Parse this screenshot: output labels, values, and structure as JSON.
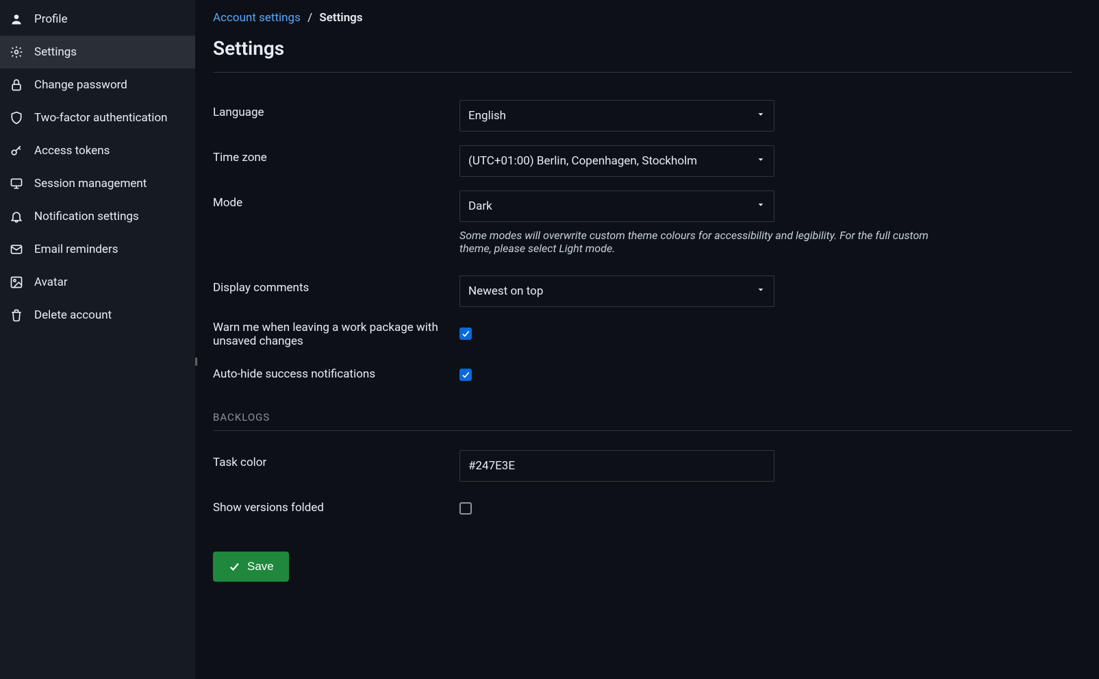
{
  "sidebar": {
    "items": [
      {
        "label": "Profile"
      },
      {
        "label": "Settings"
      },
      {
        "label": "Change password"
      },
      {
        "label": "Two-factor authentication"
      },
      {
        "label": "Access tokens"
      },
      {
        "label": "Session management"
      },
      {
        "label": "Notification settings"
      },
      {
        "label": "Email reminders"
      },
      {
        "label": "Avatar"
      },
      {
        "label": "Delete account"
      }
    ]
  },
  "breadcrumb": {
    "parent": "Account settings",
    "sep": "/",
    "current": "Settings"
  },
  "title": "Settings",
  "form": {
    "language_label": "Language",
    "language_value": "English",
    "timezone_label": "Time zone",
    "timezone_value": "(UTC+01:00) Berlin, Copenhagen, Stockholm",
    "mode_label": "Mode",
    "mode_value": "Dark",
    "mode_help": "Some modes will overwrite custom theme colours for accessibility and legibility. For the full custom theme, please select Light mode.",
    "comments_label": "Display comments",
    "comments_value": "Newest on top",
    "warn_label": "Warn me when leaving a work package with unsaved changes",
    "autohide_label": "Auto-hide success notifications",
    "backlogs_header": "BACKLOGS",
    "taskcolor_label": "Task color",
    "taskcolor_value": "#247E3E",
    "versions_label": "Show versions folded",
    "save_label": "Save"
  }
}
